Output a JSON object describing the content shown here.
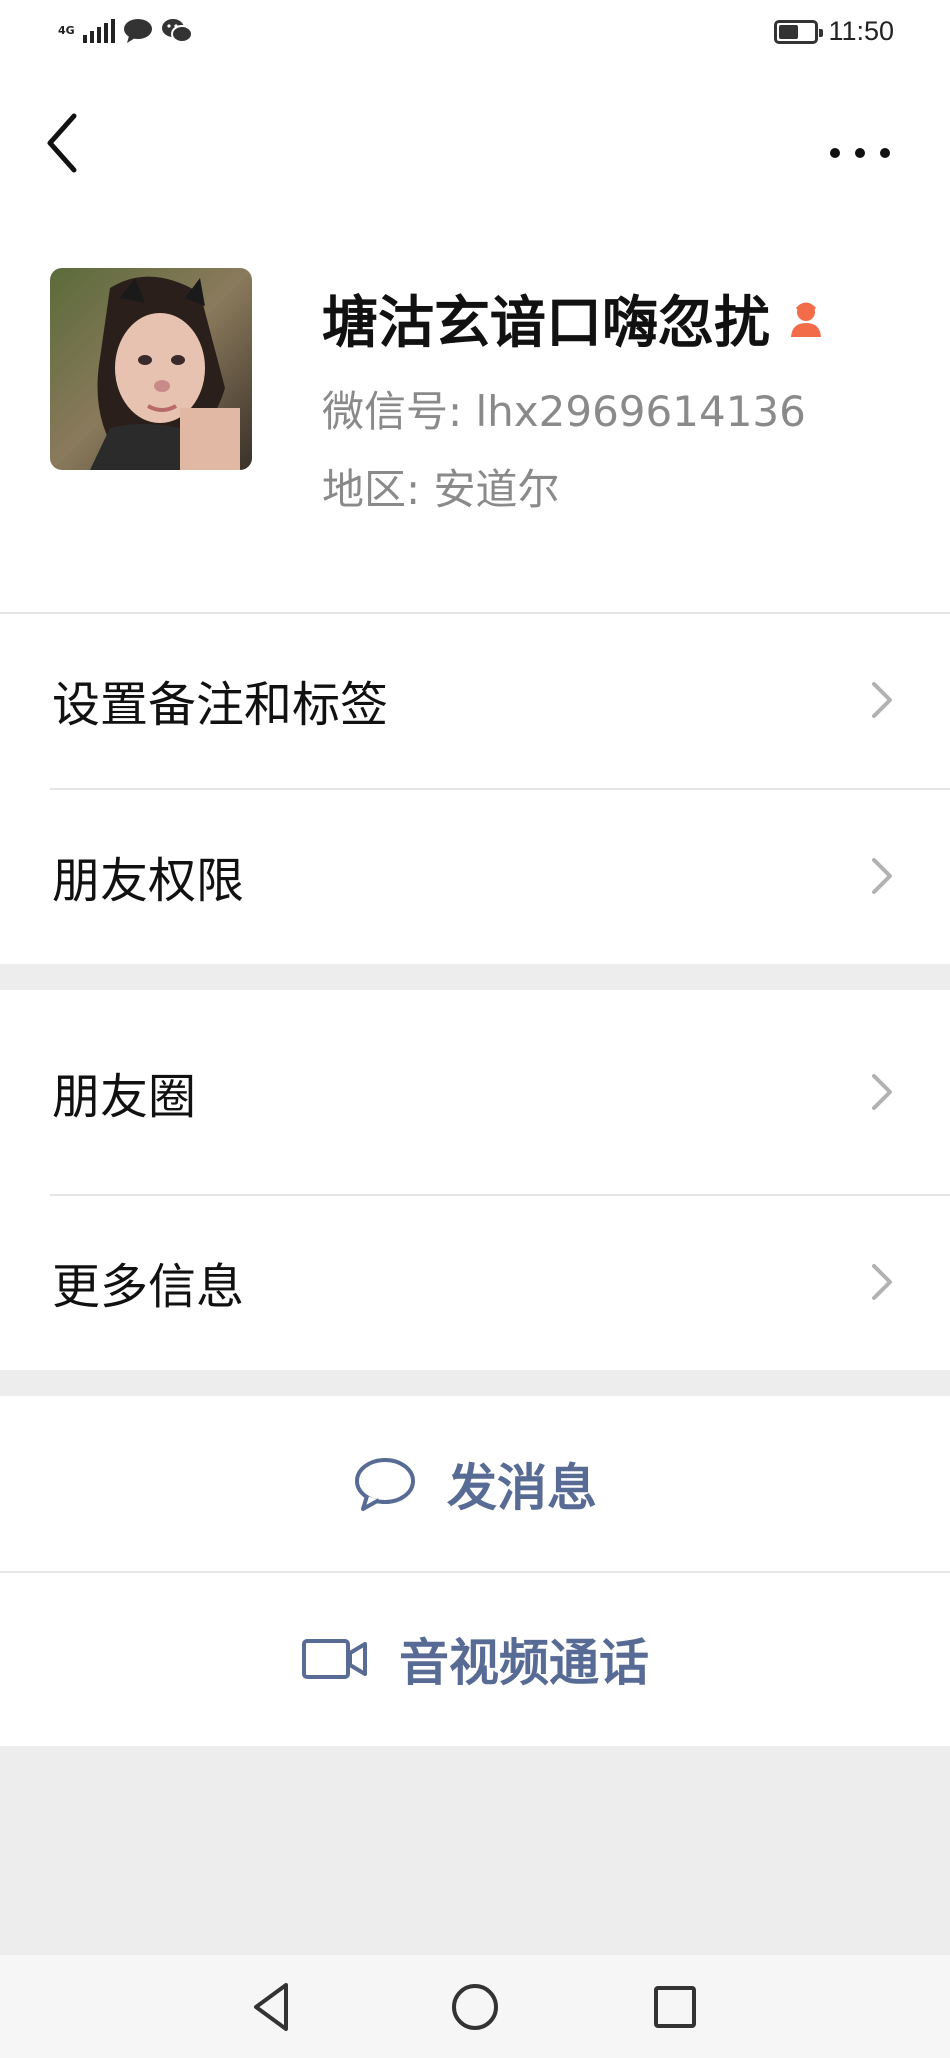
{
  "status_bar": {
    "network": "4G",
    "time": "11:50",
    "battery_level": 0.55,
    "notification_icons": [
      "message-bubble-icon",
      "wechat-icon"
    ]
  },
  "nav": {
    "back_icon": "chevron-left-icon",
    "more_icon": "more-horizontal-icon"
  },
  "profile": {
    "nickname": "塘沽玄谙口嗨忽扰",
    "gender_icon": "female-icon",
    "wechat_id": "微信号: lhx2969614136",
    "region": "地区: 安道尔"
  },
  "menu_group1": [
    {
      "label": "设置备注和标签"
    },
    {
      "label": "朋友权限"
    }
  ],
  "menu_group2": [
    {
      "label": "朋友圈"
    },
    {
      "label": "更多信息"
    }
  ],
  "actions": {
    "send_message": "发消息",
    "av_call": "音视频通话"
  },
  "colors": {
    "link": "#576b95",
    "gender_female": "#f36c4a",
    "background": "#ededed"
  }
}
